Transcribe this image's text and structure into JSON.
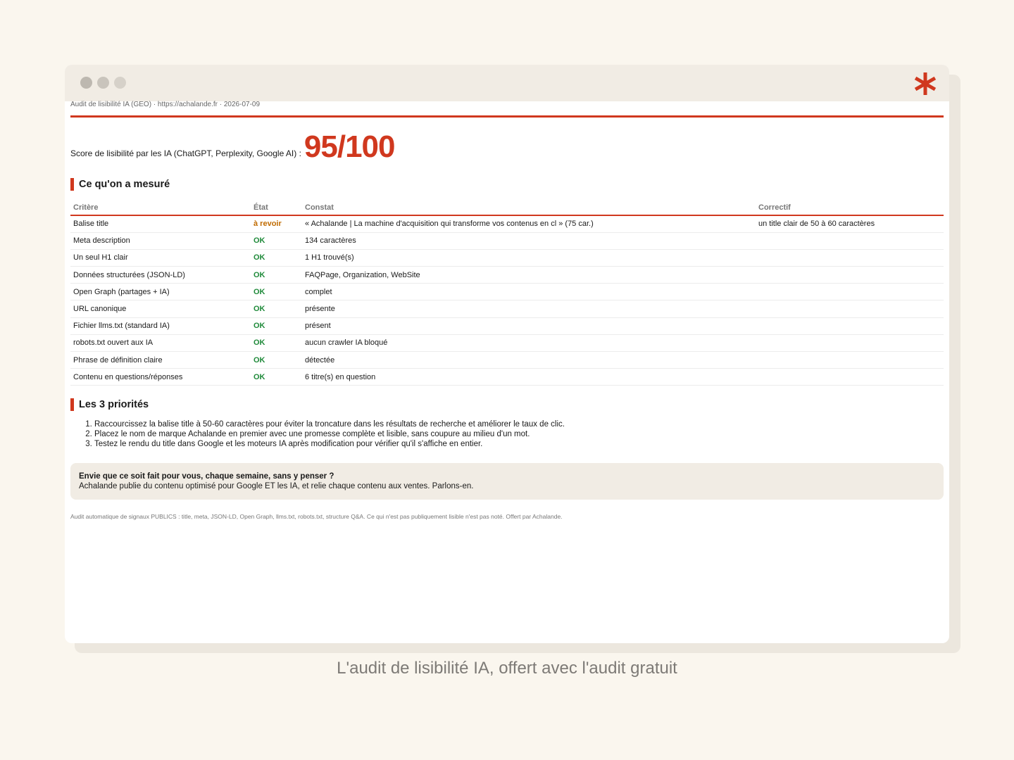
{
  "window": {
    "meta_line": "Audit de lisibilité IA (GEO) · https://achalande.fr · 2026-07-09",
    "brand_icon": "asterisk-icon",
    "accent_color": "#d0381e"
  },
  "score": {
    "label": "Score de lisibilité par les IA (ChatGPT, Perplexity, Google AI) :",
    "value": "95/100"
  },
  "measures": {
    "title": "Ce qu'on a mesuré",
    "headers": [
      "Critère",
      "État",
      "Constat",
      "Correctif"
    ],
    "rows": [
      {
        "criterion": "Balise title",
        "state": "à revoir",
        "status": "warn",
        "finding": "« Achalande | La machine d'acquisition qui transforme vos contenus en cl » (75 car.)",
        "fix": "un title clair de 50 à 60 caractères"
      },
      {
        "criterion": "Meta description",
        "state": "OK",
        "status": "ok",
        "finding": "134 caractères",
        "fix": ""
      },
      {
        "criterion": "Un seul H1 clair",
        "state": "OK",
        "status": "ok",
        "finding": "1 H1 trouvé(s)",
        "fix": ""
      },
      {
        "criterion": "Données structurées (JSON-LD)",
        "state": "OK",
        "status": "ok",
        "finding": "FAQPage, Organization, WebSite",
        "fix": ""
      },
      {
        "criterion": "Open Graph (partages + IA)",
        "state": "OK",
        "status": "ok",
        "finding": "complet",
        "fix": ""
      },
      {
        "criterion": "URL canonique",
        "state": "OK",
        "status": "ok",
        "finding": "présente",
        "fix": ""
      },
      {
        "criterion": "Fichier llms.txt (standard IA)",
        "state": "OK",
        "status": "ok",
        "finding": "présent",
        "fix": ""
      },
      {
        "criterion": "robots.txt ouvert aux IA",
        "state": "OK",
        "status": "ok",
        "finding": "aucun crawler IA bloqué",
        "fix": ""
      },
      {
        "criterion": "Phrase de définition claire",
        "state": "OK",
        "status": "ok",
        "finding": "détectée",
        "fix": ""
      },
      {
        "criterion": "Contenu en questions/réponses",
        "state": "OK",
        "status": "ok",
        "finding": "6 titre(s) en question",
        "fix": ""
      }
    ]
  },
  "priorities": {
    "title": "Les 3 priorités",
    "items": [
      "Raccourcissez la balise title à 50-60 caractères pour éviter la troncature dans les résultats de recherche et améliorer le taux de clic.",
      "Placez le nom de marque Achalande en premier avec une promesse complète et lisible, sans coupure au milieu d'un mot.",
      "Testez le rendu du title dans Google et les moteurs IA après modification pour vérifier qu'il s'affiche en entier."
    ]
  },
  "cta": {
    "title": "Envie que ce soit fait pour vous, chaque semaine, sans y penser ?",
    "text": "Achalande publie du contenu optimisé pour Google ET les IA, et relie chaque contenu aux ventes. Parlons-en."
  },
  "footnote": "Audit automatique de signaux PUBLICS : title, meta, JSON-LD, Open Graph, llms.txt, robots.txt, structure Q&A. Ce qui n'est pas publiquement lisible n'est pas noté. Offert par Achalande.",
  "caption": "L'audit de lisibilité IA, offert avec l'audit gratuit"
}
